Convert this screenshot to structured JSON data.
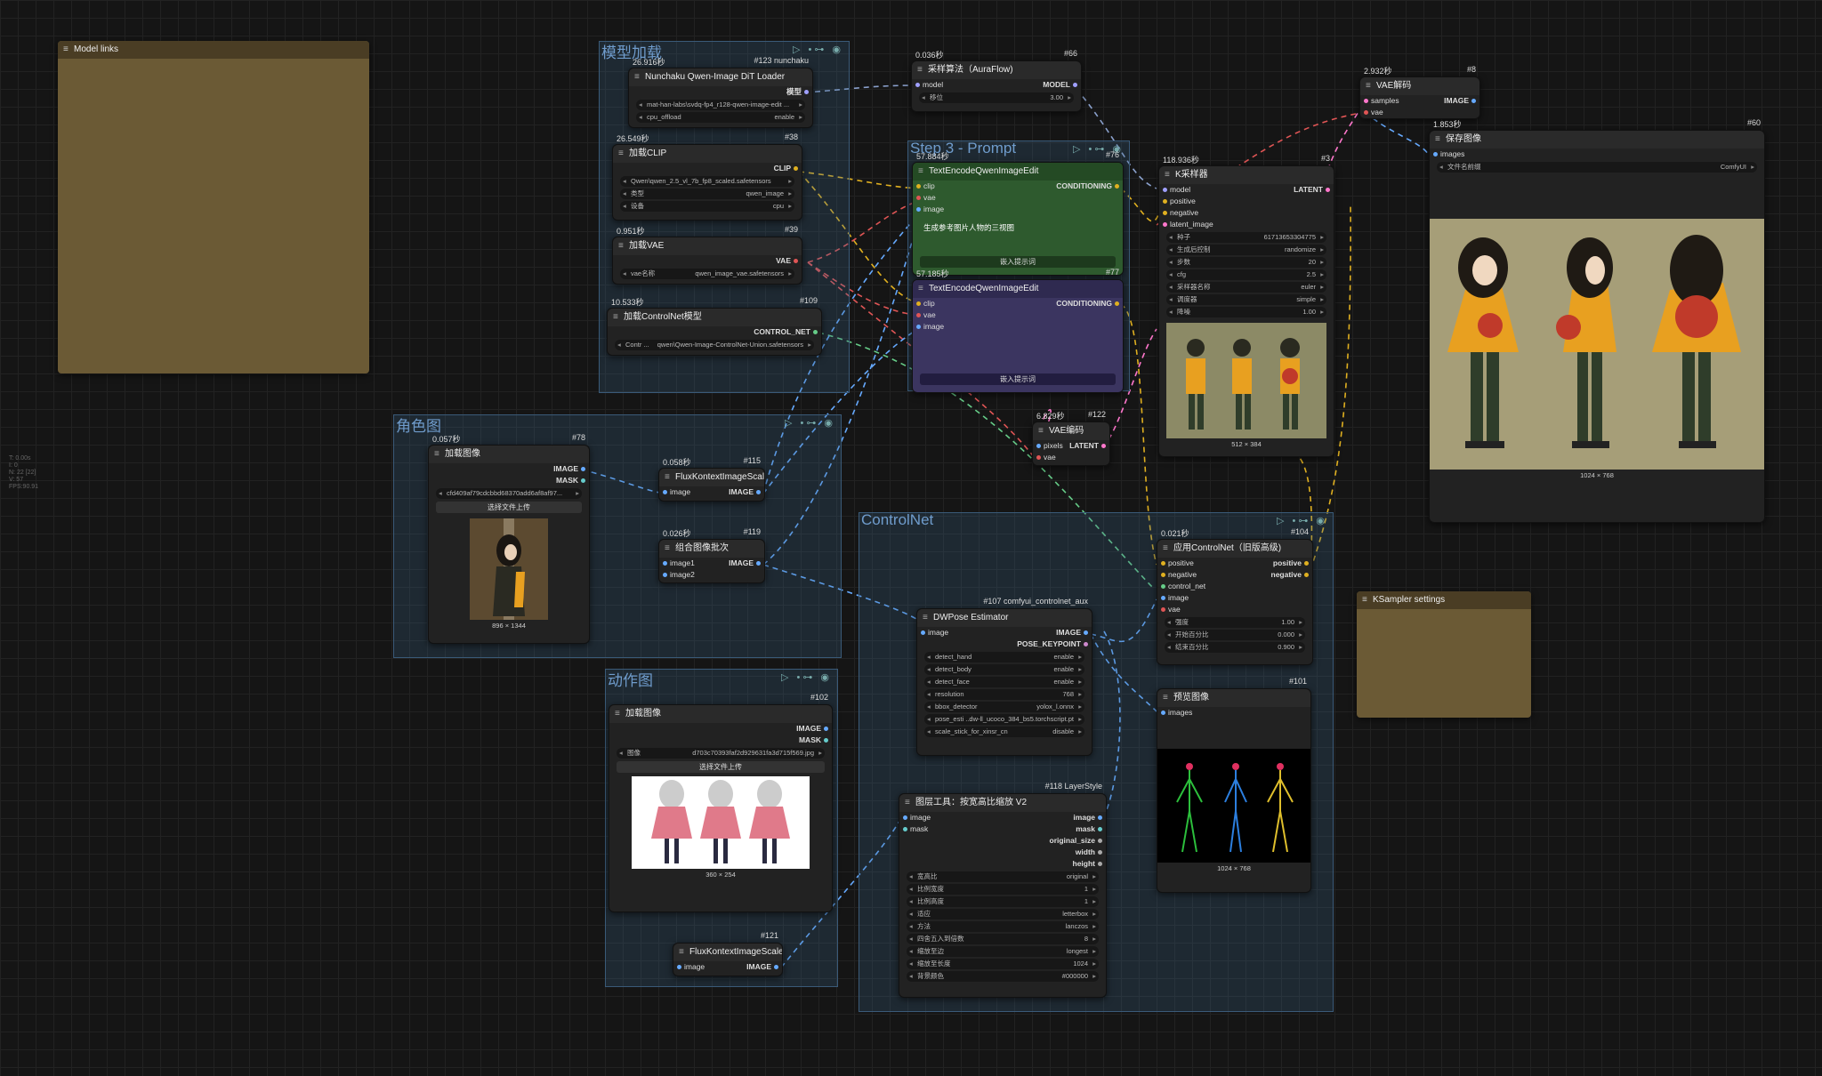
{
  "stats": [
    "T: 0.00s",
    "I: 0",
    "N: 22 [22]",
    "V: 57",
    "FPS:90.91"
  ],
  "notes": {
    "model_links": "Model links",
    "ksampler_settings": "KSampler settings"
  },
  "groups": {
    "model": "模型加载",
    "step3": "Step 3 - Prompt",
    "role": "角色图",
    "action": "动作图",
    "controlnet": "ControlNet"
  },
  "n123": {
    "time": "26.916秒",
    "id": "#123 nunchaku",
    "title": "Nunchaku Qwen-Image DiT Loader",
    "out": "模型",
    "model_name": "mat-han-labs\\svdq-fp4_r128-qwen-image-edit ...",
    "cpu_offload_k": "cpu_offload",
    "cpu_offload_v": "enable"
  },
  "n38": {
    "time": "26.549秒",
    "id": "#38",
    "title": "加载CLIP",
    "out": "CLIP",
    "clip_name": "Qwen\\qwen_2.5_vl_7b_fp8_scaled.safetensors",
    "type_k": "类型",
    "type_v": "qwen_image",
    "device_k": "设备",
    "device_v": "cpu"
  },
  "n39": {
    "time": "0.951秒",
    "id": "#39",
    "title": "加载VAE",
    "out": "VAE",
    "k": "vae名称",
    "v": "qwen_image_vae.safetensors"
  },
  "n109": {
    "time": "10.533秒",
    "id": "#109",
    "title": "加载ControlNet模型",
    "out": "CONTROL_NET",
    "k": "Contr ...",
    "v": "qwen\\Qwen-Image-ControlNet-Union.safetensors"
  },
  "n66": {
    "time": "0.036秒",
    "id": "#66",
    "title": "采样算法（AuraFlow)",
    "in": "model",
    "out": "MODEL",
    "k": "移位",
    "v": "3.00"
  },
  "n76": {
    "time": "57.884秒",
    "id": "#76",
    "title": "TextEncodeQwenImageEdit",
    "in1": "clip",
    "in2": "vae",
    "in3": "image",
    "out": "CONDITIONING",
    "text": "生成参考图片人物的三视图",
    "btn": "嵌入提示词"
  },
  "n77": {
    "time": "57.185秒",
    "id": "#77",
    "title": "TextEncodeQwenImageEdit",
    "in1": "clip",
    "in2": "vae",
    "in3": "image",
    "out": "CONDITIONING",
    "btn": "嵌入提示词"
  },
  "n3": {
    "time": "118.936秒",
    "id": "#3",
    "title": "K采样器",
    "inputs": [
      "model",
      "positive",
      "negative",
      "latent_image"
    ],
    "out": "LATENT",
    "widgets": [
      [
        "种子",
        "617136533047​75"
      ],
      [
        "生成后控制",
        "randomize"
      ],
      [
        "步数",
        "20"
      ],
      [
        "cfg",
        "2.5"
      ],
      [
        "采样器名称",
        "euler"
      ],
      [
        "调度器",
        "simple"
      ],
      [
        "降噪",
        "1.00"
      ]
    ],
    "cap": "512 × 384"
  },
  "n8": {
    "time": "2.932秒",
    "id": "#8",
    "title": "VAE解码",
    "in1": "samples",
    "in2": "vae",
    "out": "IMAGE"
  },
  "n60": {
    "time": "1.853秒",
    "id": "#60",
    "title": "保存图像",
    "in": "images",
    "k": "文件名前缀",
    "v": "ComfyUI",
    "cap": "1024 × 768"
  },
  "n122": {
    "time": "6.829秒",
    "id": "#122",
    "title": "VAE编码",
    "in1": "pixels",
    "in2": "vae",
    "out": "LATENT"
  },
  "n78": {
    "time": "0.057秒",
    "id": "#78",
    "title": "加载图像",
    "out1": "IMAGE",
    "out2": "MASK",
    "file": "cfd409af79cdcbbd68370add6af8af97...",
    "btn": "选择文件上传",
    "cap": "896 × 1344"
  },
  "n115": {
    "time": "0.058秒",
    "id": "#115",
    "title": "FluxKontextImageScale",
    "in": "image",
    "out": "IMAGE"
  },
  "n119": {
    "time": "0.026秒",
    "id": "#119",
    "title": "组合图像批次",
    "in1": "image1",
    "in2": "image2",
    "out": "IMAGE"
  },
  "n102": {
    "id": "#102",
    "title": "加载图像",
    "out1": "IMAGE",
    "out2": "MASK",
    "k": "图像",
    "v": "d703c70393faf2d929631fa3d715f569.jpg",
    "btn": "选择文件上传",
    "cap": "360 × 254"
  },
  "n121": {
    "id": "#121",
    "title": "FluxKontextImageScale",
    "in": "image",
    "out": "IMAGE"
  },
  "n104": {
    "time": "0.021秒",
    "id": "#104",
    "title": "应用ControlNet（旧版高级)",
    "inputs": [
      "positive",
      "negative",
      "control_net",
      "image",
      "vae"
    ],
    "out1": "positive",
    "out2": "negative",
    "widgets": [
      [
        "强度",
        "1.00"
      ],
      [
        "开始百分比",
        "0.000"
      ],
      [
        "结束百分比",
        "0.900"
      ]
    ]
  },
  "n107": {
    "id": "#107 comfyui_controlnet_aux",
    "title": "DWPose Estimator",
    "in": "image",
    "out1": "IMAGE",
    "out2": "POSE_KEYPOINT",
    "widgets": [
      [
        "detect_hand",
        "enable"
      ],
      [
        "detect_body",
        "enable"
      ],
      [
        "detect_face",
        "enable"
      ],
      [
        "resolution",
        "768"
      ],
      [
        "bbox_detector",
        "yolox_l.onnx"
      ],
      [
        "pose_esti ...",
        "dw-ll_ucoco_384_bs5.torchscript.pt"
      ],
      [
        "scale_stick_for_xinsr_cn",
        "disable"
      ]
    ]
  },
  "n101": {
    "id": "#101",
    "title": "预览图像",
    "in": "images",
    "cap": "1024 × 768"
  },
  "n118": {
    "id": "#118 LayerStyle",
    "title": "图层工具：按宽高比缩放 V2",
    "in1": "image",
    "in2": "mask",
    "outs": [
      "image",
      "mask",
      "original_size",
      "width",
      "height"
    ],
    "widgets": [
      [
        "宽高比",
        "original"
      ],
      [
        "比例宽度",
        "1"
      ],
      [
        "比例高度",
        "1"
      ],
      [
        "适应",
        "letterbox"
      ],
      [
        "方法",
        "lanczos"
      ],
      [
        "四舍五入到倍数",
        "8"
      ],
      [
        "缩放至边",
        "longest"
      ],
      [
        "缩放至长度",
        "1024"
      ],
      [
        "背景颜色",
        "#000000"
      ]
    ]
  },
  "colors": {
    "group_fill": "#3a668c",
    "note_brown": "#6b5a35",
    "note_header": "#4a3d24",
    "step3_green": "#2e5a2e",
    "step3_purple": "#3b3560",
    "accent_cond": "#e0b020",
    "accent_image": "#66aaff",
    "accent_latent": "#ff77cc"
  }
}
